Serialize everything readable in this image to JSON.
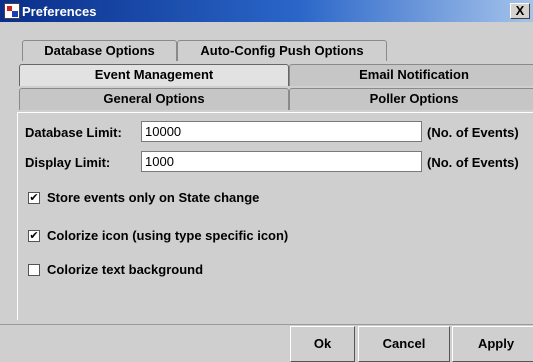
{
  "window": {
    "title": "Preferences",
    "close_glyph": "X"
  },
  "tabs": {
    "row1": [
      "Database Options",
      "Auto-Config Push Options"
    ],
    "row2": [
      "Event Management",
      "Email Notification"
    ],
    "row3": [
      "General Options",
      "Poller Options"
    ],
    "selected": "Event Management"
  },
  "form": {
    "database_limit": {
      "label": "Database Limit:",
      "value": "10000",
      "unit": "(No. of Events)"
    },
    "display_limit": {
      "label": "Display Limit:",
      "value": "1000",
      "unit": "(No. of Events)"
    },
    "checkboxes": [
      {
        "label": "Store events only on State change",
        "checked": true
      },
      {
        "label": "Colorize icon (using type specific icon)",
        "checked": true
      },
      {
        "label": "Colorize text background",
        "checked": false
      }
    ],
    "check_glyph": "✔"
  },
  "buttons": {
    "ok": "Ok",
    "cancel": "Cancel",
    "apply": "Apply"
  }
}
